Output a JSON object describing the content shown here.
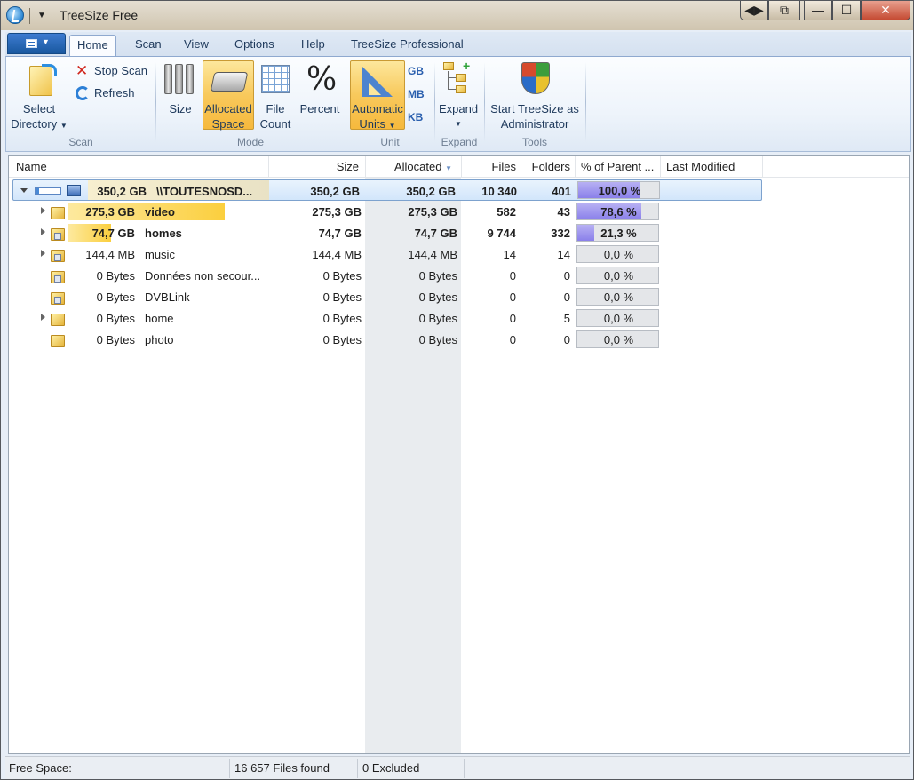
{
  "window": {
    "title": "TreeSize Free",
    "controls": [
      "◀▶",
      "⧉",
      "—",
      "☐",
      "✕"
    ]
  },
  "tabs": [
    "Home",
    "Scan",
    "View",
    "Options",
    "Help",
    "TreeSize Professional"
  ],
  "ribbon": {
    "scan": {
      "select_line1": "Select",
      "select_line2": "Directory",
      "stop": "Stop Scan",
      "refresh": "Refresh",
      "group": "Scan"
    },
    "mode": {
      "size": "Size",
      "alloc_line1": "Allocated",
      "alloc_line2": "Space",
      "count_line1": "File",
      "count_line2": "Count",
      "percent": "Percent",
      "group": "Mode"
    },
    "unit": {
      "auto_line1": "Automatic",
      "auto_line2": "Units",
      "gb": "GB",
      "mb": "MB",
      "kb": "KB",
      "group": "Unit"
    },
    "expand": {
      "label": "Expand",
      "group": "Expand"
    },
    "tools": {
      "line1": "Start TreeSize as",
      "line2": "Administrator",
      "group": "Tools"
    }
  },
  "columns": {
    "name": "Name",
    "size": "Size",
    "allocated": "Allocated",
    "files": "Files",
    "folders": "Folders",
    "pct": "% of Parent ...",
    "modified": "Last Modified"
  },
  "root": {
    "size_label": "350,2 GB",
    "name": "\\\\TOUTESNOSD...",
    "size": "350,2 GB",
    "allocated": "350,2 GB",
    "files": "10 340",
    "folders": "401",
    "pct": "100,0 %",
    "pct_value": 100.0
  },
  "rows": [
    {
      "size_label": "275,3 GB",
      "name": "video",
      "size": "275,3 GB",
      "allocated": "275,3 GB",
      "files": "582",
      "folders": "43",
      "pct": "78,6 %",
      "pct_value": 78.6,
      "bar_fraction": 1.0
    },
    {
      "size_label": "74,7 GB",
      "name": "homes",
      "size": "74,7 GB",
      "allocated": "74,7 GB",
      "files": "9 744",
      "folders": "332",
      "pct": "21,3 %",
      "pct_value": 21.3,
      "bar_fraction": 0.27
    },
    {
      "size_label": "144,4 MB",
      "name": "music",
      "size": "144,4 MB",
      "allocated": "144,4 MB",
      "files": "14",
      "folders": "14",
      "pct": "0,0 %",
      "pct_value": 0
    },
    {
      "size_label": "0 Bytes",
      "name": "Données non secour...",
      "size": "0 Bytes",
      "allocated": "0 Bytes",
      "files": "0",
      "folders": "0",
      "pct": "0,0 %",
      "pct_value": 0
    },
    {
      "size_label": "0 Bytes",
      "name": "DVBLink",
      "size": "0 Bytes",
      "allocated": "0 Bytes",
      "files": "0",
      "folders": "0",
      "pct": "0,0 %",
      "pct_value": 0
    },
    {
      "size_label": "0 Bytes",
      "name": "home",
      "size": "0 Bytes",
      "allocated": "0 Bytes",
      "files": "0",
      "folders": "5",
      "pct": "0,0 %",
      "pct_value": 0
    },
    {
      "size_label": "0 Bytes",
      "name": "photo",
      "size": "0 Bytes",
      "allocated": "0 Bytes",
      "files": "0",
      "folders": "0",
      "pct": "0,0 %",
      "pct_value": 0
    }
  ],
  "status": {
    "free_space": "Free Space:",
    "files_found": "16 657 Files found",
    "excluded": "0 Excluded"
  },
  "colors": {
    "accent": "#2a5fae",
    "selected_mode": "#f8c95c",
    "pct_bar": "#8a80ea",
    "size_bar": "#fbcf3e"
  }
}
